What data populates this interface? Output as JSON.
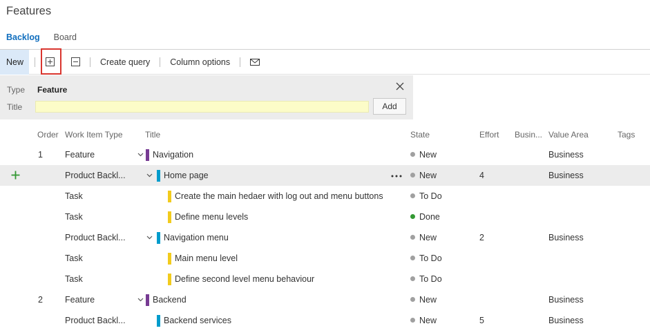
{
  "page": {
    "title": "Features"
  },
  "tabs": [
    {
      "label": "Backlog",
      "active": true
    },
    {
      "label": "Board",
      "active": false
    }
  ],
  "toolbar": {
    "new_label": "New",
    "expand_icon": "expand-all-icon",
    "collapse_icon": "collapse-all-icon",
    "create_query_label": "Create query",
    "column_options_label": "Column options",
    "email_icon": "mail-icon"
  },
  "quick_add": {
    "type_label": "Type",
    "type_value": "Feature",
    "title_label": "Title",
    "title_value": "",
    "add_label": "Add"
  },
  "columns": {
    "order": "Order",
    "work_item_type": "Work Item Type",
    "title": "Title",
    "state": "State",
    "effort": "Effort",
    "business": "Busin...",
    "value_area": "Value Area",
    "tags": "Tags"
  },
  "rows": [
    {
      "order": "1",
      "type": "Feature",
      "title": "Navigation",
      "state": "New",
      "effort": "",
      "value_area": "Business"
    },
    {
      "order": "",
      "type": "Product Backl...",
      "title": "Home page",
      "state": "New",
      "effort": "4",
      "value_area": "Business"
    },
    {
      "order": "",
      "type": "Task",
      "title": "Create the main hedaer with log out and menu buttons",
      "state": "To Do",
      "effort": "",
      "value_area": ""
    },
    {
      "order": "",
      "type": "Task",
      "title": "Define menu levels",
      "state": "Done",
      "effort": "",
      "value_area": ""
    },
    {
      "order": "",
      "type": "Product Backl...",
      "title": "Navigation menu",
      "state": "New",
      "effort": "2",
      "value_area": "Business"
    },
    {
      "order": "",
      "type": "Task",
      "title": "Main menu level",
      "state": "To Do",
      "effort": "",
      "value_area": ""
    },
    {
      "order": "",
      "type": "Task",
      "title": "Define second level menu behaviour",
      "state": "To Do",
      "effort": "",
      "value_area": ""
    },
    {
      "order": "2",
      "type": "Feature",
      "title": "Backend",
      "state": "New",
      "effort": "",
      "value_area": "Business"
    },
    {
      "order": "",
      "type": "Product Backl...",
      "title": "Backend services",
      "state": "New",
      "effort": "5",
      "value_area": "Business"
    }
  ],
  "colors": {
    "feature": "#773b93",
    "product_backlog_item": "#009ccc",
    "task": "#f2cb1d",
    "state_new": "#a0a0a0",
    "state_done": "#339933",
    "accent": "#106ebe",
    "highlight": "#d9352e"
  }
}
